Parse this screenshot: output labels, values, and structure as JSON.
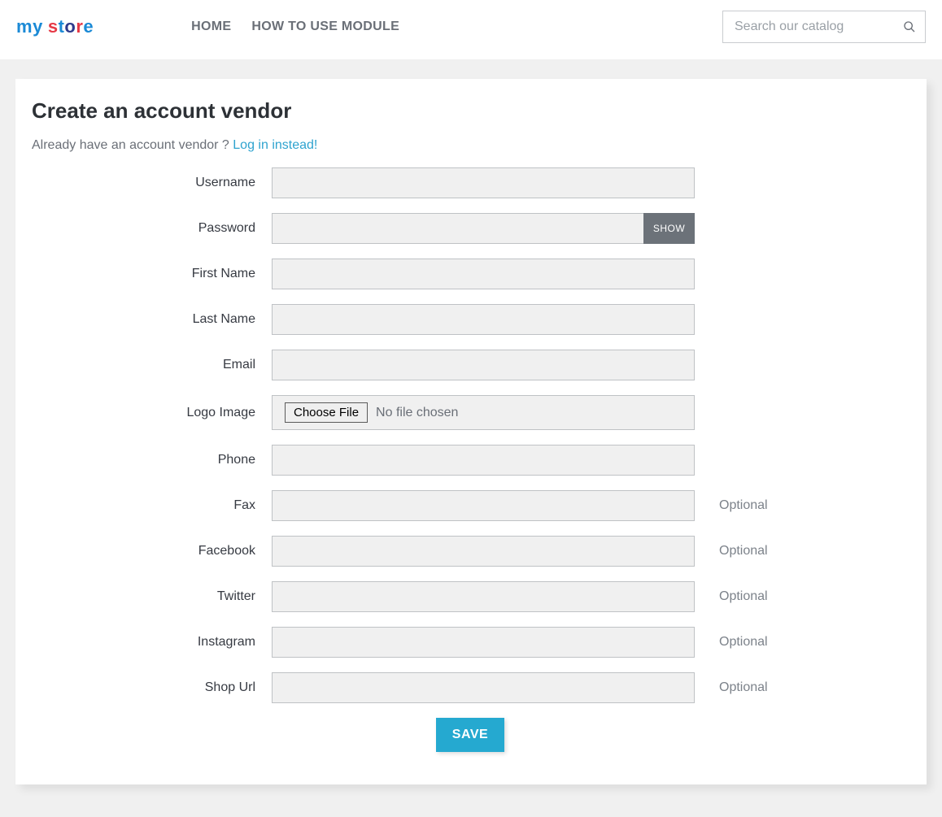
{
  "header": {
    "logo_text": "my store",
    "nav": [
      {
        "label": "HOME"
      },
      {
        "label": "HOW TO USE MODULE"
      }
    ],
    "search_placeholder": "Search our catalog"
  },
  "page": {
    "title": "Create an account vendor",
    "already_text": "Already have an account vendor ? ",
    "login_link": "Log in instead!"
  },
  "form": {
    "fields": [
      {
        "label": "Username",
        "type": "text"
      },
      {
        "label": "Password",
        "type": "password",
        "show_label": "SHOW"
      },
      {
        "label": "First Name",
        "type": "text"
      },
      {
        "label": "Last Name",
        "type": "text"
      },
      {
        "label": "Email",
        "type": "text"
      },
      {
        "label": "Logo Image",
        "type": "file",
        "button_label": "Choose File",
        "status_text": "No file chosen"
      },
      {
        "label": "Phone",
        "type": "text"
      },
      {
        "label": "Fax",
        "type": "text",
        "hint": "Optional"
      },
      {
        "label": "Facebook",
        "type": "text",
        "hint": "Optional"
      },
      {
        "label": "Twitter",
        "type": "text",
        "hint": "Optional"
      },
      {
        "label": "Instagram",
        "type": "text",
        "hint": "Optional"
      },
      {
        "label": "Shop Url",
        "type": "text",
        "hint": "Optional"
      }
    ],
    "save_label": "SAVE"
  }
}
